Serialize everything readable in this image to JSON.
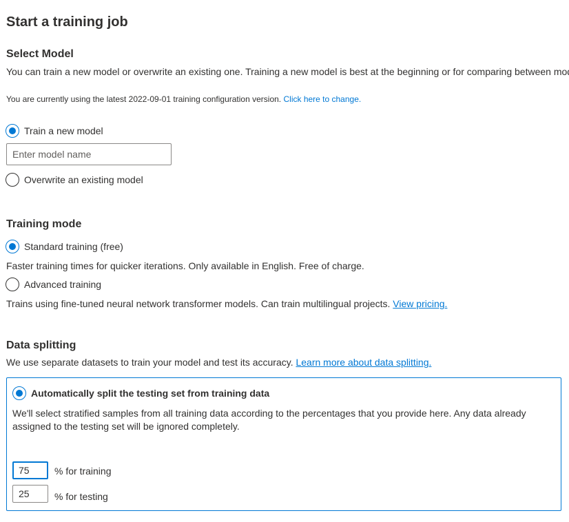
{
  "page": {
    "title": "Start a training job"
  },
  "select_model": {
    "heading": "Select Model",
    "description": "You can train a new model or overwrite an existing one. Training a new model is best at the beginning or for comparing between mod",
    "config_note": "You are currently using the latest 2022-09-01 training configuration version.",
    "config_link": "Click here to change.",
    "options": [
      {
        "label": "Train a new model",
        "checked": true
      },
      {
        "label": "Overwrite an existing model",
        "checked": false
      }
    ],
    "model_name_placeholder": "Enter model name",
    "model_name_value": ""
  },
  "training_mode": {
    "heading": "Training mode",
    "options": [
      {
        "label": "Standard training (free)",
        "checked": true,
        "description": "Faster training times for quicker iterations. Only available in English. Free of charge."
      },
      {
        "label": "Advanced training",
        "checked": false,
        "description": "Trains using fine-tuned neural network transformer models. Can train multilingual projects.",
        "link": "View pricing."
      }
    ]
  },
  "data_splitting": {
    "heading": "Data splitting",
    "description": "We use separate datasets to train your model and test its accuracy.",
    "link": "Learn more about data splitting.",
    "auto_option": {
      "label": "Automatically split the testing set from training data",
      "checked": true,
      "description_line1": "We'll select stratified samples from all training data according to the percentages that you provide here. Any data already",
      "description_line2": "assigned to the testing set will be ignored completely."
    },
    "training_percent": {
      "value": "75",
      "label": "% for training"
    },
    "testing_percent": {
      "value": "25",
      "label": "% for testing"
    }
  },
  "colors": {
    "accent": "#0078d4",
    "text": "#323130",
    "border": "#8a8886"
  }
}
